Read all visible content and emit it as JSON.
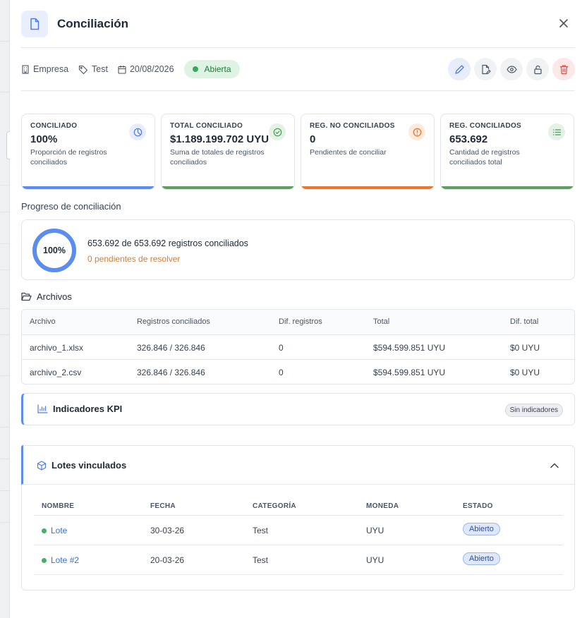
{
  "header": {
    "title": "Conciliación"
  },
  "meta": {
    "company": "Empresa",
    "tag": "Test",
    "date": "20/08/2026",
    "status": "Abierta"
  },
  "colors": {
    "accent": "#5b8def",
    "green": "#5f9e5f",
    "orange": "#e8782f",
    "danger": "#d9534f"
  },
  "cards": [
    {
      "label": "CONCILIADO",
      "value": "100%",
      "desc": "Proporción de registros conciliados",
      "icon": "pie-chart-icon"
    },
    {
      "label": "TOTAL CONCILIADO",
      "value": "$1.189.199.702 UYU",
      "desc": "Suma de totales de registros conciliados",
      "icon": "check-circle-icon"
    },
    {
      "label": "REG. NO CONCILIADOS",
      "value": "0",
      "desc": "Pendientes de conciliar",
      "icon": "alert-circle-icon"
    },
    {
      "label": "REG. CONCILIADOS",
      "value": "653.692",
      "desc": "Cantidad de registros conciliados total",
      "icon": "list-icon"
    }
  ],
  "progress": {
    "section_title": "Progreso de conciliación",
    "percent_label": "100%",
    "percent": 100,
    "main_text": "653.692 de 653.692 registros conciliados",
    "pending_text": "0 pendientes de resolver"
  },
  "files": {
    "title": "Archivos",
    "columns": [
      "Archivo",
      "Registros conciliados",
      "Dif. registros",
      "Total",
      "Dif. total"
    ],
    "rows": [
      [
        "archivo_1.xlsx",
        "326.846 / 326.846",
        "0",
        "$594.599.851 UYU",
        "$0 UYU"
      ],
      [
        "archivo_2.csv",
        "326.846 / 326.846",
        "0",
        "$594.599.851 UYU",
        "$0 UYU"
      ]
    ]
  },
  "kpi": {
    "title": "Indicadores KPI",
    "badge": "Sin indicadores"
  },
  "lotes": {
    "title": "Lotes vinculados",
    "columns": [
      "NOMBRE",
      "FECHA",
      "CATEGORÍA",
      "MONEDA",
      "ESTADO"
    ],
    "rows": [
      [
        "Lote",
        "30-03-26",
        "Test",
        "UYU",
        "Abierto"
      ],
      [
        "Lote #2",
        "20-03-26",
        "Test",
        "UYU",
        "Abierto"
      ]
    ]
  }
}
